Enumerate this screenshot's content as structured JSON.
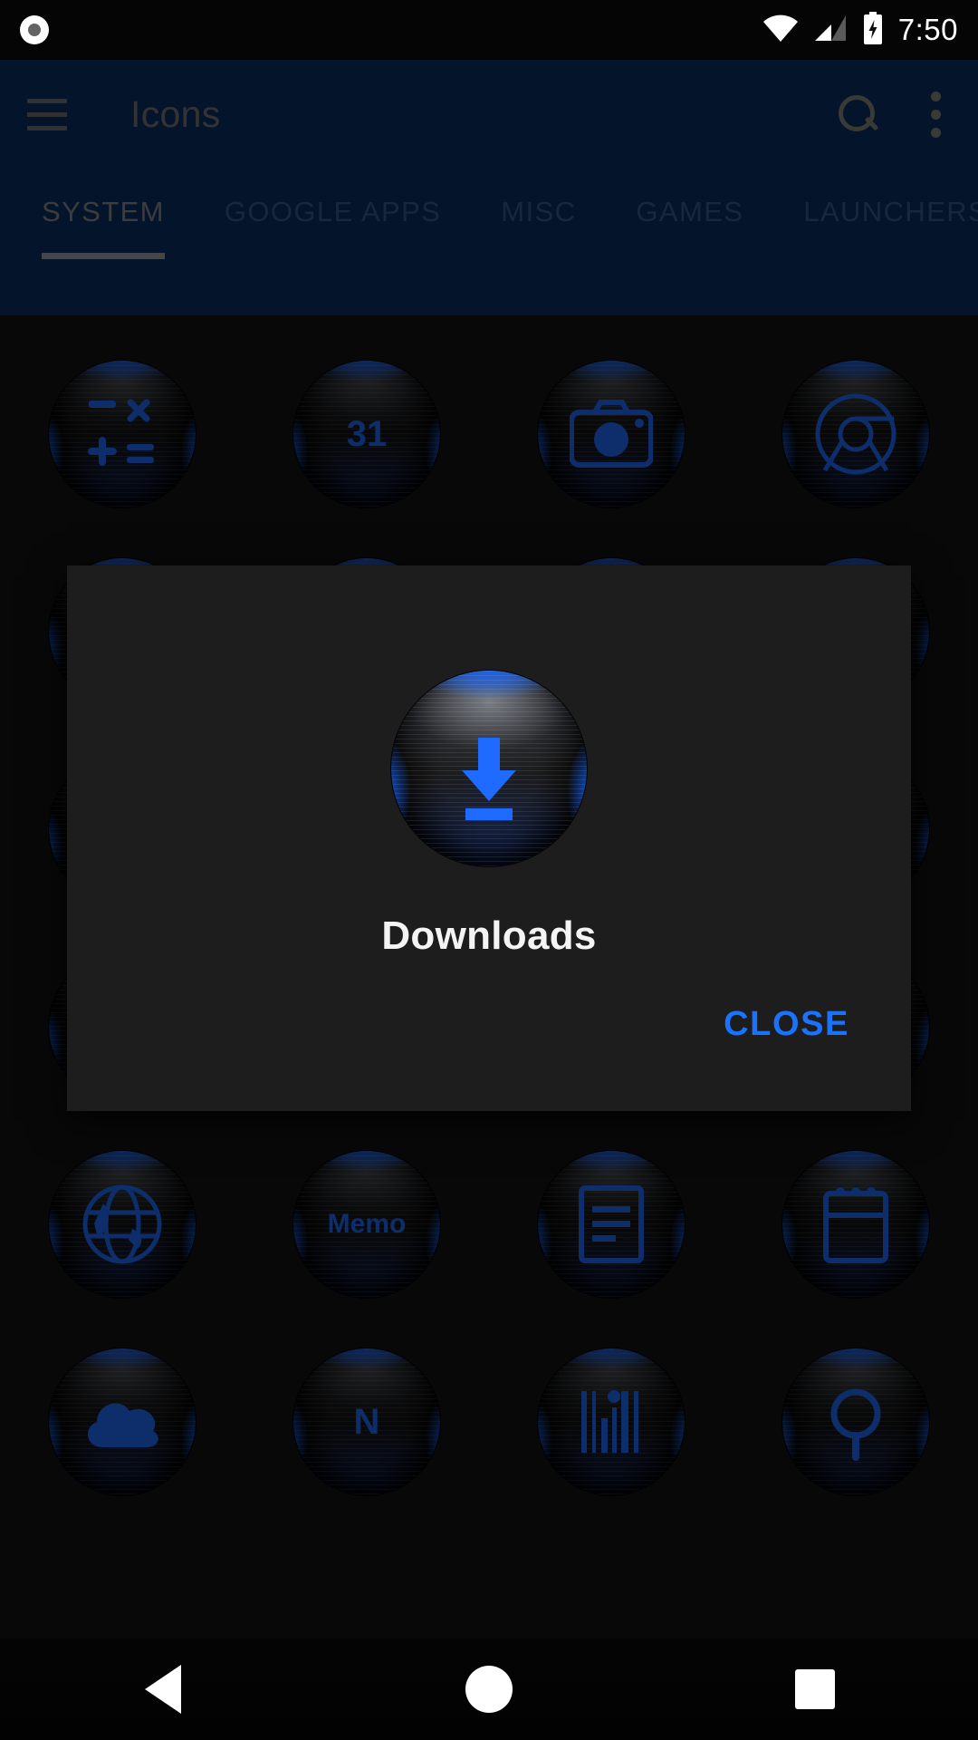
{
  "statusbar": {
    "time": "7:50",
    "icons": [
      "record-icon",
      "wifi-icon",
      "cellular-signal-icon",
      "battery-charging-icon"
    ]
  },
  "appbar": {
    "title": "Icons",
    "menu_icon": "hamburger-menu-icon",
    "search_icon": "search-icon",
    "overflow_icon": "overflow-menu-icon",
    "background_color": "#0a3268",
    "tabs": [
      {
        "label": "SYSTEM",
        "active": true
      },
      {
        "label": "GOOGLE APPS",
        "active": false
      },
      {
        "label": "MISC",
        "active": false
      },
      {
        "label": "GAMES",
        "active": false
      },
      {
        "label": "LAUNCHERS",
        "active": false
      }
    ]
  },
  "dialog": {
    "title": "Downloads",
    "close_label": "CLOSE",
    "close_color": "#1a73ff",
    "icon_name": "downloads-icon",
    "background_color": "#1d1d1d"
  },
  "grid": {
    "accent_color": "#1f6bff",
    "rows": [
      [
        {
          "name": "calculator-icon",
          "glyph": "calculator"
        },
        {
          "name": "calendar-icon",
          "glyph": "text",
          "text": "31"
        },
        {
          "name": "camera-icon",
          "glyph": "camera"
        },
        {
          "name": "chrome-icon",
          "glyph": "chrome"
        }
      ],
      [
        {
          "name": "clock-icon",
          "glyph": "clock"
        },
        {
          "name": "contacts-icon",
          "glyph": "contacts"
        },
        {
          "name": "downloads-icon",
          "glyph": "download"
        },
        {
          "name": "dialer-icon",
          "glyph": "phone"
        }
      ],
      [
        {
          "name": "files-icon",
          "glyph": "folder"
        },
        {
          "name": "gallery-icon",
          "glyph": "gallery"
        },
        {
          "name": "messages-icon",
          "glyph": "message"
        },
        {
          "name": "music-icon",
          "glyph": "music"
        }
      ],
      [
        {
          "name": "drive-icon",
          "glyph": "drive"
        },
        {
          "name": "gmail-icon",
          "glyph": "mail"
        },
        {
          "name": "photo-editor-icon",
          "glyph": "editor"
        },
        {
          "name": "instagram-icon",
          "glyph": "instagram"
        }
      ],
      [
        {
          "name": "browser-icon",
          "glyph": "globe"
        },
        {
          "name": "memo-icon",
          "glyph": "text",
          "text": "Memo"
        },
        {
          "name": "documents-icon",
          "glyph": "document"
        },
        {
          "name": "notes-icon",
          "glyph": "note"
        }
      ],
      [
        {
          "name": "cloud-icon",
          "glyph": "cloud"
        },
        {
          "name": "onenote-icon",
          "glyph": "text",
          "text": "N"
        },
        {
          "name": "scanner-icon",
          "glyph": "barcode"
        },
        {
          "name": "search-app-icon",
          "glyph": "magnifier"
        }
      ]
    ]
  },
  "navbar": {
    "back_label": "back-button",
    "home_label": "home-button",
    "recents_label": "recents-button"
  }
}
